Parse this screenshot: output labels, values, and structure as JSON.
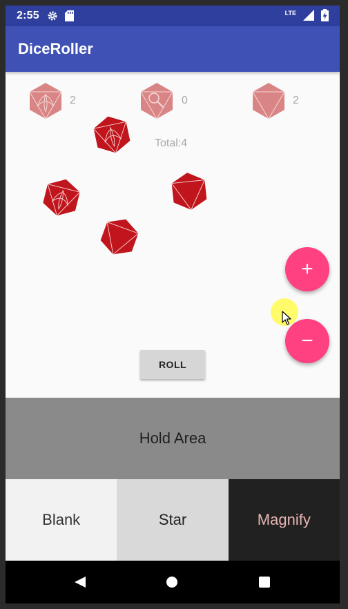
{
  "status_bar": {
    "time": "2:55",
    "network": "LTE",
    "icons": [
      "gear-icon",
      "sd-card-icon",
      "signal-icon",
      "battery-charging-icon"
    ]
  },
  "app_bar": {
    "title": "DiceRoller"
  },
  "face_counts": [
    {
      "icon": "star-face-icon",
      "count": "2"
    },
    {
      "icon": "magnify-face-icon",
      "count": "0"
    },
    {
      "icon": "blank-face-icon",
      "count": "2"
    }
  ],
  "total": "Total:4",
  "dice": [
    {
      "face": "star"
    },
    {
      "face": "star"
    },
    {
      "face": "blank"
    },
    {
      "face": "blank"
    }
  ],
  "roll_button": {
    "label": "ROLL"
  },
  "fab": {
    "add_symbol": "+",
    "remove_symbol": "−"
  },
  "hold_area": {
    "label": "Hold Area"
  },
  "tabs": [
    {
      "label": "Blank"
    },
    {
      "label": "Star"
    },
    {
      "label": "Magnify"
    }
  ],
  "colors": {
    "status_bar": "#2f3f9e",
    "app_bar": "#3f51b5",
    "die_active": "#c0151c",
    "die_faded": "#d98585",
    "fab": "#ff4081",
    "hold_area": "#8a8a8a"
  }
}
